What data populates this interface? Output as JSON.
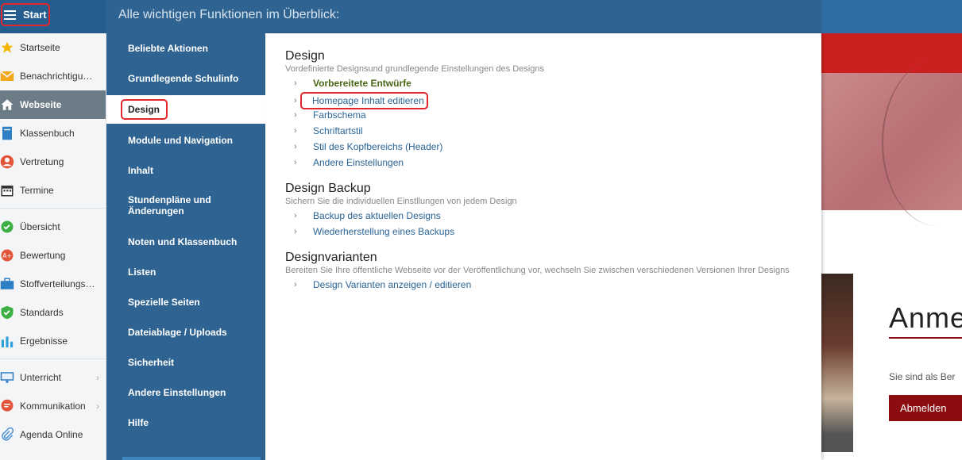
{
  "topbar": {
    "start_label": "Start",
    "menu_heading": "Alle wichtigen Funktionen im Überblick:"
  },
  "sidebar": {
    "items": [
      {
        "label": "Startseite",
        "icon": "star-icon"
      },
      {
        "label": "Benachrichtigungen",
        "icon": "mail-icon"
      },
      {
        "label": "Webseite",
        "icon": "home-icon"
      },
      {
        "label": "Klassenbuch",
        "icon": "book-icon"
      },
      {
        "label": "Vertretung",
        "icon": "user-icon"
      },
      {
        "label": "Termine",
        "icon": "calendar-icon"
      },
      {
        "label": "Übersicht",
        "icon": "check-circle-icon"
      },
      {
        "label": "Bewertung",
        "icon": "grade-icon"
      },
      {
        "label": "Stoffverteilungsplan",
        "icon": "briefcase-icon"
      },
      {
        "label": "Standards",
        "icon": "shield-check-icon"
      },
      {
        "label": "Ergebnisse",
        "icon": "bar-chart-icon"
      },
      {
        "label": "Unterricht",
        "icon": "board-icon"
      },
      {
        "label": "Kommunikation",
        "icon": "chat-icon"
      },
      {
        "label": "Agenda Online",
        "icon": "paperclip-icon"
      }
    ]
  },
  "mega": {
    "categories": [
      "Beliebte Aktionen",
      "Grundlegende Schulinfo",
      "Design",
      "Module und Navigation",
      "Inhalt",
      "Stundenpläne und Änderungen",
      "Noten und Klassenbuch",
      "Listen",
      "Spezielle Seiten",
      "Dateiablage / Uploads",
      "Sicherheit",
      "Andere Einstellungen",
      "Hilfe"
    ],
    "sections": [
      {
        "title": "Design",
        "subtitle": "Vordefinierte Designsund grundlegende Einstellungen des Designs",
        "links": [
          "Vorbereitete Entwürfe",
          "Homepage Inhalt editieren",
          "Farbschema",
          "Schriftartstil",
          "Stil des Kopfbereichs (Header)",
          "Andere Einstellungen"
        ]
      },
      {
        "title": "Design Backup",
        "subtitle": "Sichern Sie die individuellen Einstllungen von jedem Design",
        "links": [
          "Backup des aktuellen Designs",
          "Wiederherstellung eines Backups"
        ]
      },
      {
        "title": "Designvarianten",
        "subtitle": "Bereiten Sie Ihre öffentliche Webseite vor der Veröffentlichung vor, wechseln Sie zwischen verschiedenen Versionen Ihrer Designs",
        "links": [
          "Design Varianten anzeigen / editieren"
        ]
      }
    ]
  },
  "background": {
    "heading": "Anme",
    "text": "Sie sind als Ber",
    "logout_label": "Abmelden"
  },
  "colors": {
    "header": "#2f6492",
    "accent_red": "#e2262b",
    "brand_dark_red": "#8b0d10"
  }
}
